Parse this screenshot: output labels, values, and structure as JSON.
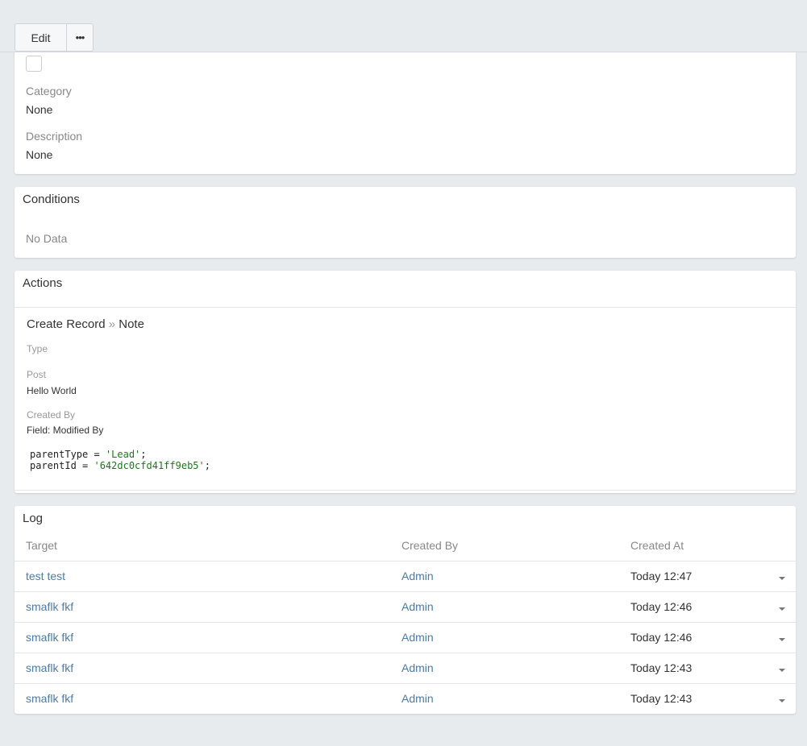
{
  "toolbar": {
    "edit_label": "Edit",
    "more_label": "•••"
  },
  "details": {
    "category_label": "Category",
    "category_value": "None",
    "description_label": "Description",
    "description_value": "None"
  },
  "conditions": {
    "title": "Conditions",
    "empty_text": "No Data"
  },
  "actions": {
    "title": "Actions",
    "action_name": "Create Record",
    "separator": "»",
    "entity": "Note",
    "type_label": "Type",
    "post_label": "Post",
    "post_value": "Hello World",
    "created_by_label": "Created By",
    "created_by_value": "Field: Modified By",
    "code_line1_prefix": "parentType = ",
    "code_line1_str": "'Lead'",
    "code_line1_suffix": ";",
    "code_line2_prefix": "parentId = ",
    "code_line2_str": "'642dc0cfd41ff9eb5'",
    "code_line2_suffix": ";"
  },
  "log": {
    "title": "Log",
    "columns": [
      "Target",
      "Created By",
      "Created At"
    ],
    "rows": [
      {
        "target": "test test",
        "created_by": "Admin",
        "created_at": "Today 12:47"
      },
      {
        "target": "smaflk fkf",
        "created_by": "Admin",
        "created_at": "Today 12:46"
      },
      {
        "target": "smaflk fkf",
        "created_by": "Admin",
        "created_at": "Today 12:46"
      },
      {
        "target": "smaflk fkf",
        "created_by": "Admin",
        "created_at": "Today 12:43"
      },
      {
        "target": "smaflk fkf",
        "created_by": "Admin",
        "created_at": "Today 12:43"
      }
    ]
  }
}
